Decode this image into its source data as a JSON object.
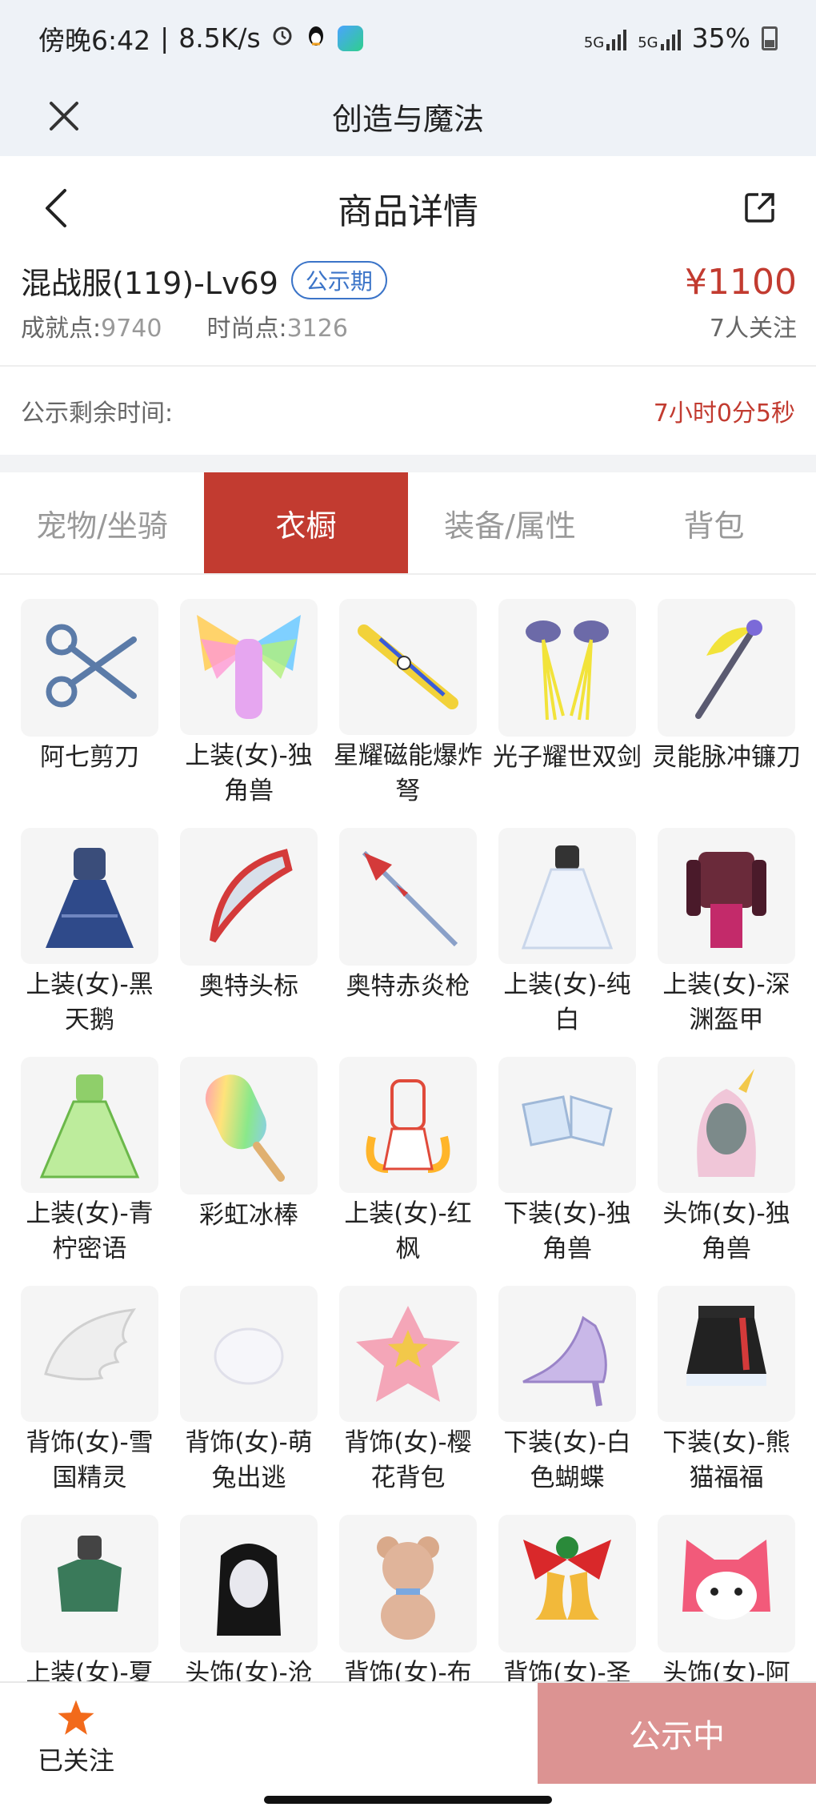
{
  "status_bar": {
    "time": "傍晚6:42",
    "net_speed": "8.5K/s",
    "signal1": "5G",
    "signal2": "5G",
    "battery": "35%"
  },
  "app_bar": {
    "title": "创造与魔法"
  },
  "page_header": {
    "title": "商品详情"
  },
  "product": {
    "name": "混战服(119)-Lv69",
    "badge": "公示期",
    "price": "¥1100",
    "achievement_label": "成就点:",
    "achievement_value": "9740",
    "fashion_label": "时尚点:",
    "fashion_value": "3126",
    "followers": "7人关注"
  },
  "countdown": {
    "label": "公示剩余时间:",
    "value": "7小时0分5秒"
  },
  "tabs": [
    {
      "label": "宠物/坐骑"
    },
    {
      "label": "衣橱"
    },
    {
      "label": "装备/属性"
    },
    {
      "label": "背包"
    }
  ],
  "items": [
    {
      "name": "阿七剪刀",
      "icon": "scissors-icon"
    },
    {
      "name": "上装(女)-独角兽",
      "icon": "rainbow-wings-outfit-icon"
    },
    {
      "name": "星耀磁能爆炸弩",
      "icon": "crossbow-icon"
    },
    {
      "name": "光子耀世双剑",
      "icon": "twin-swords-icon"
    },
    {
      "name": "灵能脉冲镰刀",
      "icon": "scythe-icon"
    },
    {
      "name": "上装(女)-黑天鹅",
      "icon": "blue-dress-icon"
    },
    {
      "name": "奥特头标",
      "icon": "crest-icon"
    },
    {
      "name": "奥特赤炎枪",
      "icon": "spear-icon"
    },
    {
      "name": "上装(女)-纯白",
      "icon": "white-dress-icon"
    },
    {
      "name": "上装(女)-深渊盔甲",
      "icon": "armor-icon"
    },
    {
      "name": "上装(女)-青柠密语",
      "icon": "green-dress-icon"
    },
    {
      "name": "彩虹冰棒",
      "icon": "popsicle-icon"
    },
    {
      "name": "上装(女)-红枫",
      "icon": "red-maple-outfit-icon"
    },
    {
      "name": "下装(女)-独角兽",
      "icon": "unicorn-pants-icon"
    },
    {
      "name": "头饰(女)-独角兽",
      "icon": "unicorn-hood-icon"
    },
    {
      "name": "背饰(女)-雪国精灵",
      "icon": "white-wing-icon"
    },
    {
      "name": "背饰(女)-萌兔出逃",
      "icon": "fluffy-tail-icon"
    },
    {
      "name": "背饰(女)-樱花背包",
      "icon": "star-backpack-icon"
    },
    {
      "name": "下装(女)-白色蝴蝶",
      "icon": "heel-shoe-icon"
    },
    {
      "name": "下装(女)-熊猫福福",
      "icon": "panda-skirt-icon"
    },
    {
      "name": "上装(女)-夏",
      "icon": "green-top-icon"
    },
    {
      "name": "头饰(女)-沧",
      "icon": "black-hair-icon"
    },
    {
      "name": "背饰(女)-布",
      "icon": "teddy-bear-icon"
    },
    {
      "name": "背饰(女)-圣",
      "icon": "christmas-bell-icon"
    },
    {
      "name": "头饰(女)-阿",
      "icon": "cat-mask-icon"
    }
  ],
  "bottom_bar": {
    "follow_label": "已关注",
    "cta_label": "公示中"
  },
  "colors": {
    "accent_red": "#c23b30",
    "badge_blue": "#3b74c8",
    "cta_pink": "#dc9392"
  }
}
